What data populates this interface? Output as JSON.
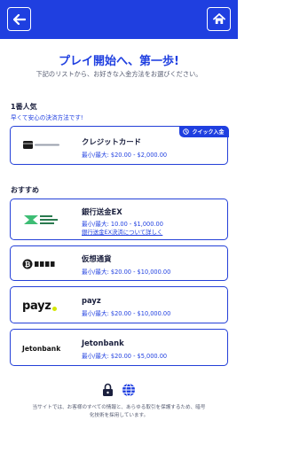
{
  "header": {
    "back_icon": "arrow-left-icon",
    "home_icon": "home-icon"
  },
  "intro": {
    "headline": "プレイ開始へ、第一歩!",
    "subline": "下記のリストから、お好きな入金方法をお選びください。"
  },
  "popular": {
    "title": "1番人気",
    "subtitle": "早くて安心の決済方法です!",
    "card": {
      "name": "クレジットカード",
      "limits": "最小/最大: $20.00 - $2,000.00",
      "badge": "クイック入金",
      "logo_text": "クレジットカード"
    }
  },
  "recommended": {
    "title": "おすすめ",
    "methods": [
      {
        "name": "銀行送金EX",
        "limits": "最小/最大: 10.00 - $1,000.00",
        "link": "銀行送金EX決済について詳しく",
        "logo_text": "銀行送金EX"
      },
      {
        "name": "仮想通貨",
        "limits": "最小/最大: $20.00 - $10,000.00",
        "logo_text": "仮想通貨"
      },
      {
        "name": "payz",
        "limits": "最小/最大: $20.00 - $10,000.00",
        "logo_text": "payz"
      },
      {
        "name": "Jetonbank",
        "limits": "最小/最大: $20.00 - $5,000.00",
        "logo_text": "Jetonbank"
      }
    ]
  },
  "footer": {
    "icons": [
      "lock-icon",
      "globe-icon"
    ],
    "text": "当サイトでは、お客様のすべての情報と、あらゆる取引を保護するため、暗号化技術を採用しています。"
  },
  "colors": {
    "brand": "#1f3fe0",
    "payz_dot": "#d4e600"
  }
}
